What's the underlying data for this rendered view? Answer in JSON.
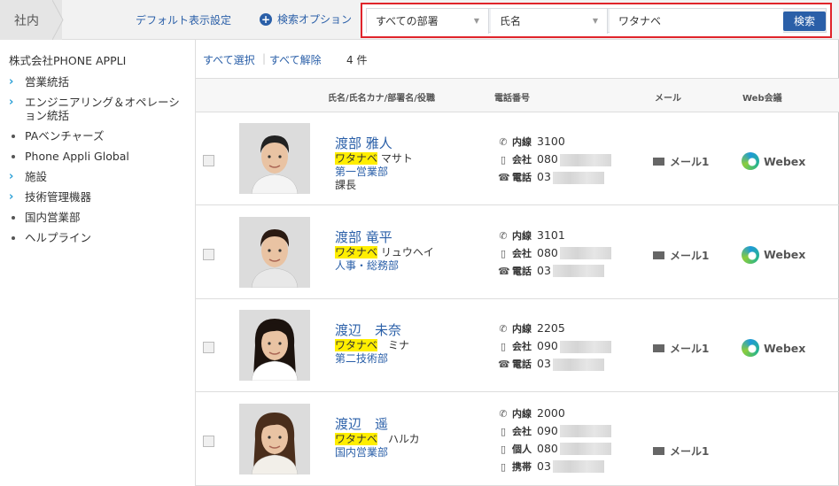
{
  "breadcrumb": {
    "label": "社内"
  },
  "header": {
    "default_link": "デフォルト表示設定",
    "search_options": "検索オプション"
  },
  "search": {
    "dept_select": "すべての部署",
    "field_select": "氏名",
    "keyword": "ワタナベ",
    "button": "検索"
  },
  "sidebar": {
    "org": "株式会社PHONE APPLI",
    "items": [
      {
        "label": "営業統括",
        "type": "expand"
      },
      {
        "label": "エンジニアリング＆オペレーション統括",
        "type": "expand"
      },
      {
        "label": "PAベンチャーズ",
        "type": "leaf"
      },
      {
        "label": "Phone Appli Global",
        "type": "leaf"
      },
      {
        "label": "施設",
        "type": "expand"
      },
      {
        "label": "技術管理機器",
        "type": "expand"
      },
      {
        "label": "国内営業部",
        "type": "leaf"
      },
      {
        "label": "ヘルプライン",
        "type": "leaf"
      }
    ]
  },
  "toolbar": {
    "select_all": "すべて選択",
    "deselect_all": "すべて解除",
    "count": "4 件"
  },
  "table": {
    "headers": {
      "name": "氏名/氏名カナ/部署名/役職",
      "phone": "電話番号",
      "mail": "メール",
      "web": "Web会議"
    },
    "rows": [
      {
        "name": "渡部 雅人",
        "kana_hl": "ワタナベ",
        "kana_rest": " マサト",
        "dept": "第一営業部",
        "title": "課長",
        "phones": [
          {
            "icon": "phone-icon",
            "label": "内線",
            "number": "3100",
            "blurred": false
          },
          {
            "icon": "mobile-icon",
            "label": "会社",
            "number": "080",
            "blurred": true
          },
          {
            "icon": "fax-icon",
            "label": "電話",
            "number": "03",
            "blurred": true
          }
        ],
        "mail": "メール1",
        "web": "Webex"
      },
      {
        "name": "渡部 竜平",
        "kana_hl": "ワタナベ",
        "kana_rest": " リュウヘイ",
        "dept": "人事・総務部",
        "title": "",
        "phones": [
          {
            "icon": "phone-icon",
            "label": "内線",
            "number": "3101",
            "blurred": false
          },
          {
            "icon": "mobile-icon",
            "label": "会社",
            "number": "080",
            "blurred": true
          },
          {
            "icon": "fax-icon",
            "label": "電話",
            "number": "03",
            "blurred": true
          }
        ],
        "mail": "メール1",
        "web": "Webex"
      },
      {
        "name": "渡辺　未奈",
        "kana_hl": "ワタナベ",
        "kana_rest": "　ミナ",
        "dept": "第二技術部",
        "title": "",
        "phones": [
          {
            "icon": "phone-icon",
            "label": "内線",
            "number": "2205",
            "blurred": false
          },
          {
            "icon": "mobile-icon",
            "label": "会社",
            "number": "090",
            "blurred": true
          },
          {
            "icon": "fax-icon",
            "label": "電話",
            "number": "03",
            "blurred": true
          }
        ],
        "mail": "メール1",
        "web": "Webex"
      },
      {
        "name": "渡辺　遥",
        "kana_hl": "ワタナベ",
        "kana_rest": "　ハルカ",
        "dept": "国内営業部",
        "title": "",
        "phones": [
          {
            "icon": "phone-icon",
            "label": "内線",
            "number": "2000",
            "blurred": false
          },
          {
            "icon": "mobile-icon",
            "label": "会社",
            "number": "090",
            "blurred": true
          },
          {
            "icon": "mobile-icon",
            "label": "個人",
            "number": "080",
            "blurred": true
          },
          {
            "icon": "mobile-icon",
            "label": "携帯",
            "number": "03",
            "blurred": true
          }
        ],
        "mail": "メール1",
        "web": ""
      }
    ]
  },
  "colors": {
    "link": "#2a5fa8",
    "highlight": "#ffee00",
    "search_border": "#e0242b",
    "button": "#2a5fa8"
  }
}
